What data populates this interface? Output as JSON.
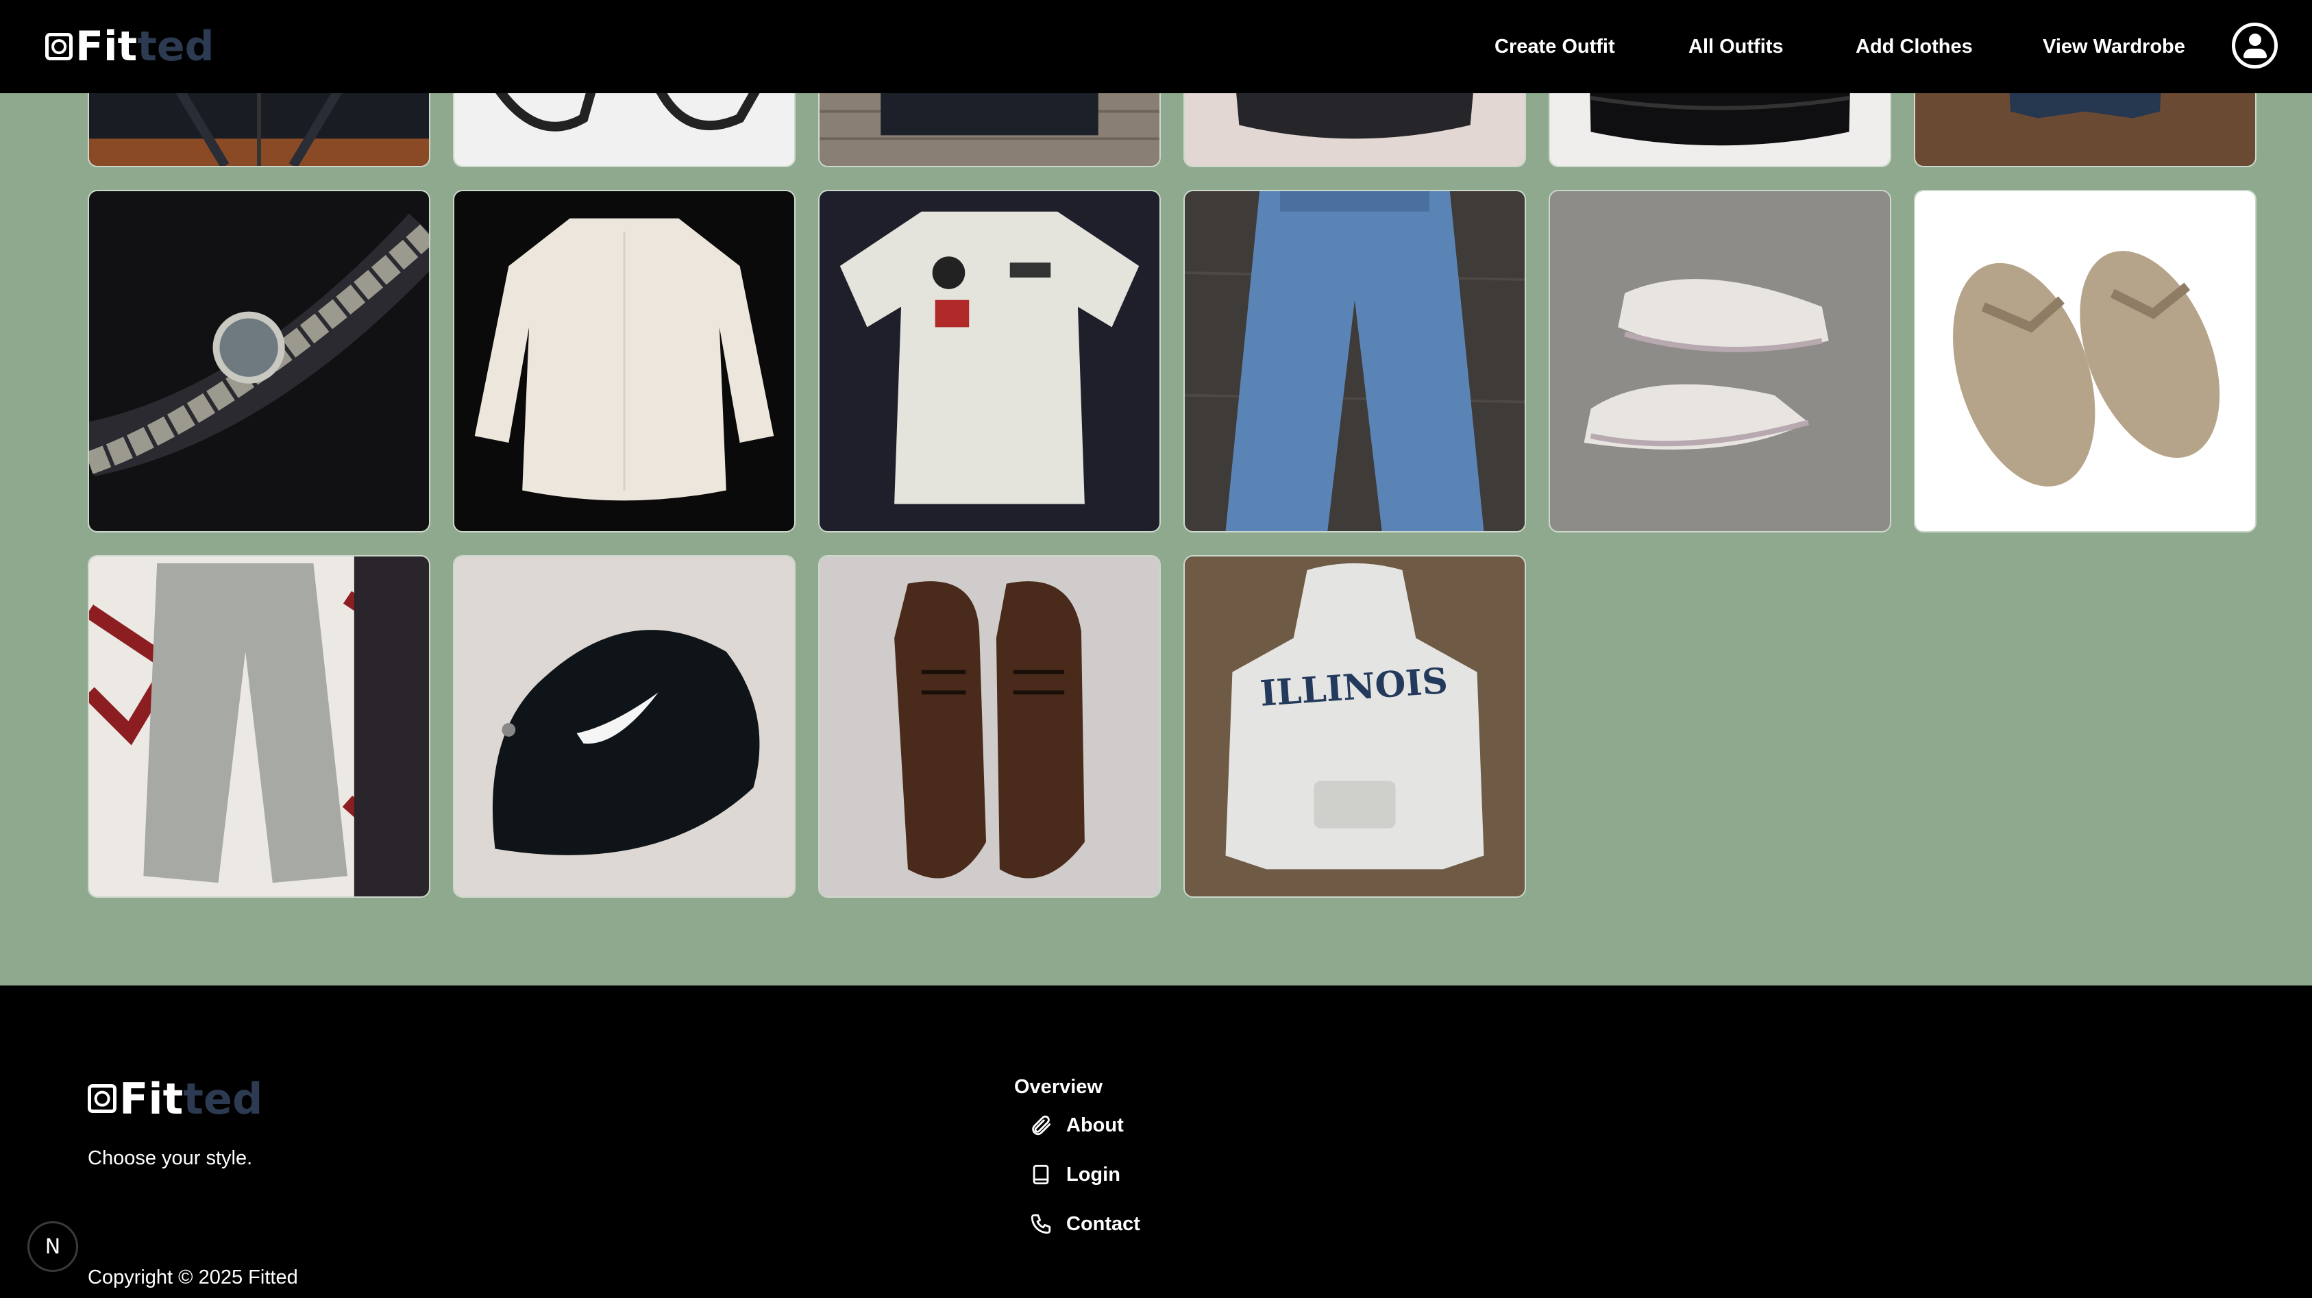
{
  "brand": {
    "part1": "Fit",
    "part2": "ted"
  },
  "nav": {
    "create_outfit": "Create Outfit",
    "all_outfits": "All Outfits",
    "add_clothes": "Add Clothes",
    "view_wardrobe": "View Wardrobe"
  },
  "wardrobe": {
    "items": [
      {
        "icon": "blazer"
      },
      {
        "icon": "glasses"
      },
      {
        "icon": "black-shirt"
      },
      {
        "icon": "black-top"
      },
      {
        "icon": "puffer-jacket"
      },
      {
        "icon": "denim-item"
      },
      {
        "icon": "watch"
      },
      {
        "icon": "dress-shirt"
      },
      {
        "icon": "graphic-tshirt"
      },
      {
        "icon": "jeans"
      },
      {
        "icon": "sneakers"
      },
      {
        "icon": "sandals"
      },
      {
        "icon": "sweatpants"
      },
      {
        "icon": "bucket-hat"
      },
      {
        "icon": "dress-shoes"
      },
      {
        "icon": "illinois-hoodie"
      }
    ],
    "hoodie_print": "ILLINOIS"
  },
  "footer": {
    "tagline": "Choose your style.",
    "overview_heading": "Overview",
    "links": {
      "about": "About",
      "login": "Login",
      "contact": "Contact"
    },
    "copyright": "Copyright © 2025 Fitted",
    "dev_badge": "N"
  },
  "colors": {
    "background": "#8ea98e",
    "header": "#000000",
    "accent": "#2c3a52"
  }
}
